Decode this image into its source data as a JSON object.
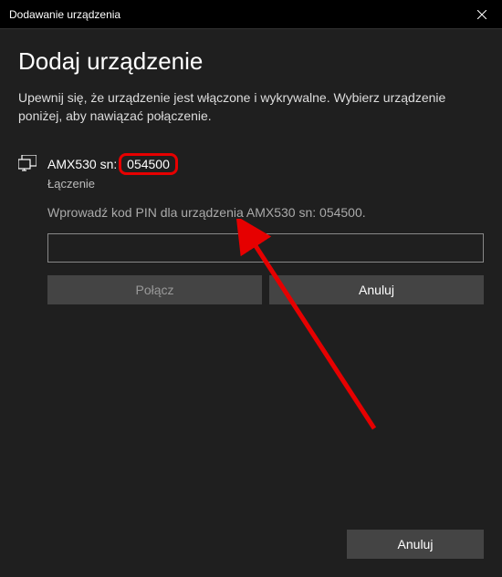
{
  "titlebar": {
    "title": "Dodawanie urządzenia"
  },
  "heading": "Dodaj urządzenie",
  "subheading": "Upewnij się, że urządzenie jest włączone i wykrywalne. Wybierz urządzenie poniżej, aby nawiązać połączenie.",
  "device": {
    "name_prefix": "AMX530 sn:",
    "serial_highlighted": "054500",
    "status": "Łączenie",
    "pin_instruction": "Wprowadź kod PIN dla urządzenia AMX530 sn: 054500.",
    "pin_value": ""
  },
  "buttons": {
    "connect": "Połącz",
    "cancel_inline": "Anuluj",
    "cancel_footer": "Anuluj"
  },
  "annotations": {
    "highlight_color": "#e60000",
    "arrow_color": "#e60000"
  }
}
